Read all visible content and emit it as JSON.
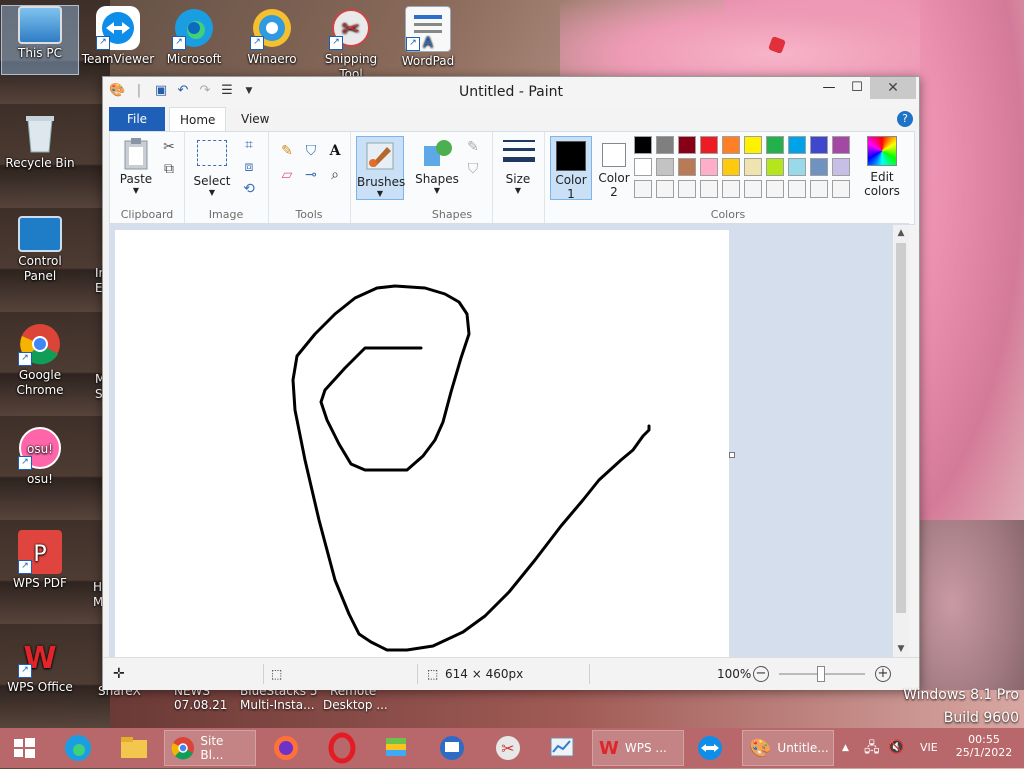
{
  "desktop": {
    "icons": [
      {
        "label": "This PC"
      },
      {
        "label": "TeamViewer"
      },
      {
        "label": "Microsoft"
      },
      {
        "label": "Winaero"
      },
      {
        "label": "Snipping Tool"
      },
      {
        "label": "WordPad"
      },
      {
        "label": "Recycle Bin"
      },
      {
        "label": "Control Panel"
      },
      {
        "label": "Google Chrome"
      },
      {
        "label": "osu!"
      },
      {
        "label": "WPS PDF"
      },
      {
        "label": "WPS Office"
      }
    ],
    "partial_labels": [
      "Ir",
      "E",
      "M",
      "Sl",
      "H",
      "M",
      "ShareX",
      "NEWS",
      "07.08.21",
      "BlueStacks 5",
      "Multi-Insta...",
      "Remote",
      "Desktop ..."
    ],
    "osu_badge": "osu!",
    "windows_version": "Windows 8.1 Pro",
    "build": "Build 9600"
  },
  "paint": {
    "title": "Untitled - Paint",
    "tabs": {
      "file": "File",
      "home": "Home",
      "view": "View"
    },
    "groups": {
      "clipboard": {
        "label": "Clipboard",
        "paste": "Paste"
      },
      "image": {
        "label": "Image",
        "select": "Select"
      },
      "tools": {
        "label": "Tools"
      },
      "brushes": {
        "label": "Brushes"
      },
      "shapes": {
        "label": "Shapes",
        "btn": "Shapes"
      },
      "size": {
        "label": "Size"
      },
      "colors": {
        "label": "Colors",
        "color1": "Color",
        "color1_num": "1",
        "color2": "Color",
        "color2_num": "2",
        "edit": "Edit",
        "edit2": "colors"
      }
    },
    "palette": [
      "#000000",
      "#7f7f7f",
      "#880015",
      "#ed1c24",
      "#ff7f27",
      "#fff200",
      "#22b14c",
      "#00a2e8",
      "#3f48cc",
      "#a349a4",
      "#ffffff",
      "#c3c3c3",
      "#b97a57",
      "#ffaec9",
      "#ffc90e",
      "#efe4b0",
      "#b5e61d",
      "#99d9ea",
      "#7092be",
      "#c8bfe7",
      "#f5f5f5",
      "#f5f5f5",
      "#f5f5f5",
      "#f5f5f5",
      "#f5f5f5",
      "#f5f5f5",
      "#f5f5f5",
      "#f5f5f5",
      "#f5f5f5",
      "#f5f5f5"
    ],
    "color1": "#000000",
    "color2": "#ffffff",
    "status": {
      "dimensions": "614 × 460px",
      "zoom": "100%"
    }
  },
  "taskbar": {
    "chrome_label": "Site Bl...",
    "wps_label": "WPS ...",
    "paint_label": "Untitle...",
    "lang": "VIE",
    "time": "00:55",
    "date": "25/1/2022"
  }
}
